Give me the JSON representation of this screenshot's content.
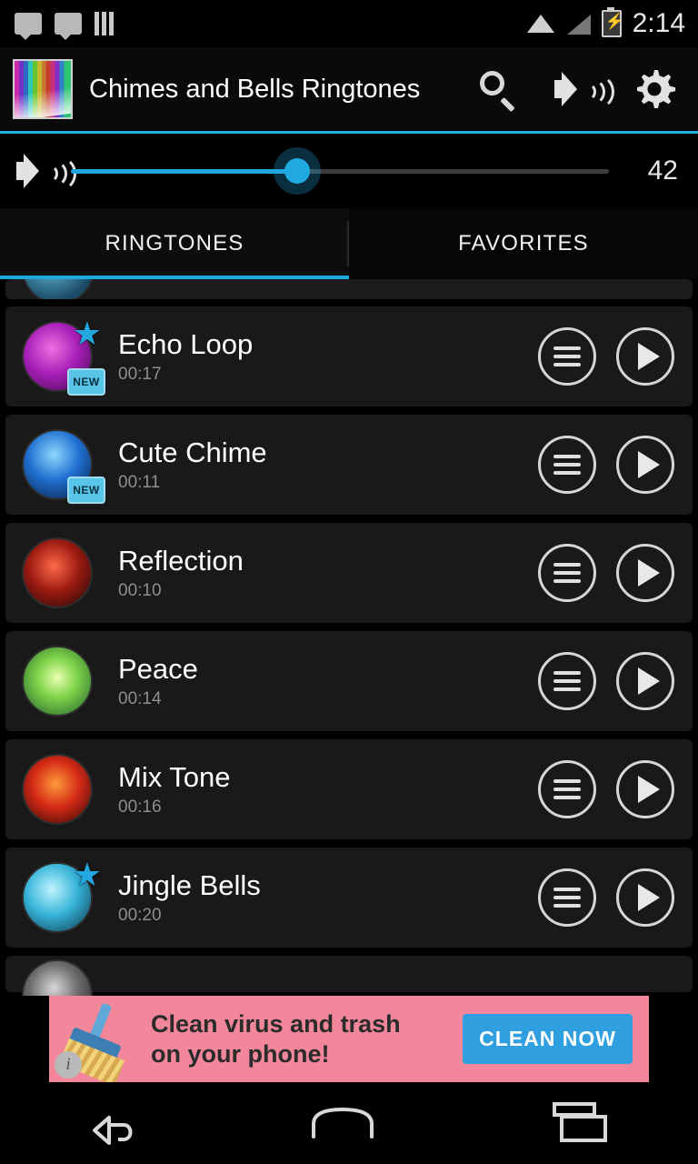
{
  "statusbar": {
    "clock": "2:14",
    "icons_left": [
      "message-icon",
      "message-icon",
      "bars-icon"
    ],
    "icons_right": [
      "wifi-icon",
      "signal-icon",
      "battery-charging-icon"
    ]
  },
  "appbar": {
    "title": "Chimes and Bells Ringtones",
    "logo_name": "app-logo",
    "actions": [
      {
        "name": "search-icon",
        "label": "Search"
      },
      {
        "name": "volume-icon",
        "label": "Volume"
      },
      {
        "name": "gear-icon",
        "label": "Settings"
      }
    ]
  },
  "volume": {
    "icon": "speaker-icon",
    "value": "42",
    "fill_percent": 42
  },
  "tabs": [
    {
      "label": "RINGTONES",
      "active": true
    },
    {
      "label": "FAVORITES",
      "active": false
    }
  ],
  "list": [
    {
      "title": "Echo Loop",
      "duration": "00:17",
      "favorite": true,
      "new": true,
      "art": "purple"
    },
    {
      "title": "Cute Chime",
      "duration": "00:11",
      "favorite": false,
      "new": true,
      "art": "blue"
    },
    {
      "title": "Reflection",
      "duration": "00:10",
      "favorite": false,
      "new": false,
      "art": "red"
    },
    {
      "title": "Peace",
      "duration": "00:14",
      "favorite": false,
      "new": false,
      "art": "green"
    },
    {
      "title": "Mix Tone",
      "duration": "00:16",
      "favorite": false,
      "new": false,
      "art": "orange"
    },
    {
      "title": "Jingle Bells",
      "duration": "00:20",
      "favorite": true,
      "new": false,
      "art": "cyan"
    }
  ],
  "row_buttons": {
    "menu": "menu-icon",
    "play": "play-icon"
  },
  "ad": {
    "line1": "Clean virus and trash",
    "line2": "on your phone!",
    "cta": "CLEAN NOW",
    "info": "i"
  },
  "navbar": [
    {
      "name": "nav-back-button"
    },
    {
      "name": "nav-home-button"
    },
    {
      "name": "nav-recents-button"
    }
  ],
  "colors": {
    "accent": "#1fa9e0",
    "background": "#000000",
    "row": "#191919",
    "ad_bg": "#f2879b",
    "ad_cta": "#2f9fe0"
  }
}
